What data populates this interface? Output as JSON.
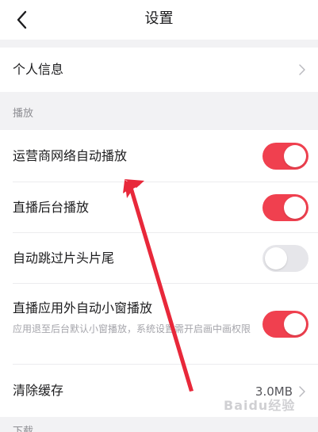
{
  "header": {
    "title": "设置"
  },
  "personal": {
    "label": "个人信息"
  },
  "playback_section": {
    "label": "播放"
  },
  "settings": [
    {
      "label": "运营商网络自动播放",
      "enabled": true
    },
    {
      "label": "直播后台播放",
      "enabled": true
    },
    {
      "label": "自动跳过片头片尾",
      "enabled": false
    },
    {
      "label": "直播应用外自动小窗播放",
      "enabled": true,
      "description": "应用退至后台默认小窗播放，系统设置需开启画中画权限"
    }
  ],
  "cache": {
    "label": "清除缓存",
    "value": "3.0MB"
  },
  "next_section": {
    "label": "下载"
  },
  "watermark": {
    "text": "Baidu经验"
  },
  "colors": {
    "accent": "#f0404f",
    "toggle_off": "#e6e6ea",
    "arrow": "#e8283a"
  }
}
